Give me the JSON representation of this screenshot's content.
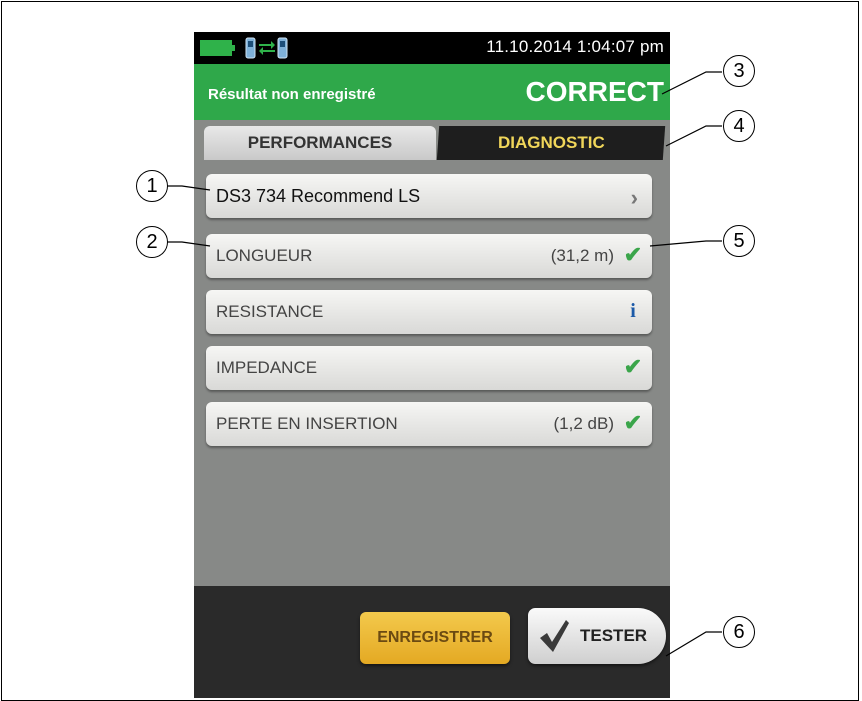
{
  "status_bar": {
    "datetime": "11.10.2014 1:04:07 pm",
    "battery_icon": "battery-icon",
    "link_icon": "connection-icon"
  },
  "result": {
    "message": "Résultat non enregistré",
    "status": "CORRECT",
    "color": "#2fa84a"
  },
  "tabs": {
    "performances": "PERFORMANCES",
    "diagnostic": "DIAGNOSTIC"
  },
  "test_limit": {
    "label": "DS3 734 Recommend LS"
  },
  "results": [
    {
      "label": "LONGUEUR",
      "value": "(31,2 m)",
      "status_icon": "pass-check-icon"
    },
    {
      "label": "RESISTANCE",
      "value": "",
      "status_icon": "info-icon"
    },
    {
      "label": "IMPEDANCE",
      "value": "",
      "status_icon": "pass-check-icon"
    },
    {
      "label": "PERTE EN INSERTION",
      "value": "(1,2 dB)",
      "status_icon": "pass-check-icon"
    }
  ],
  "buttons": {
    "save": "ENREGISTRER",
    "test": "TESTER"
  },
  "callouts": [
    "1",
    "2",
    "3",
    "4",
    "5",
    "6"
  ]
}
